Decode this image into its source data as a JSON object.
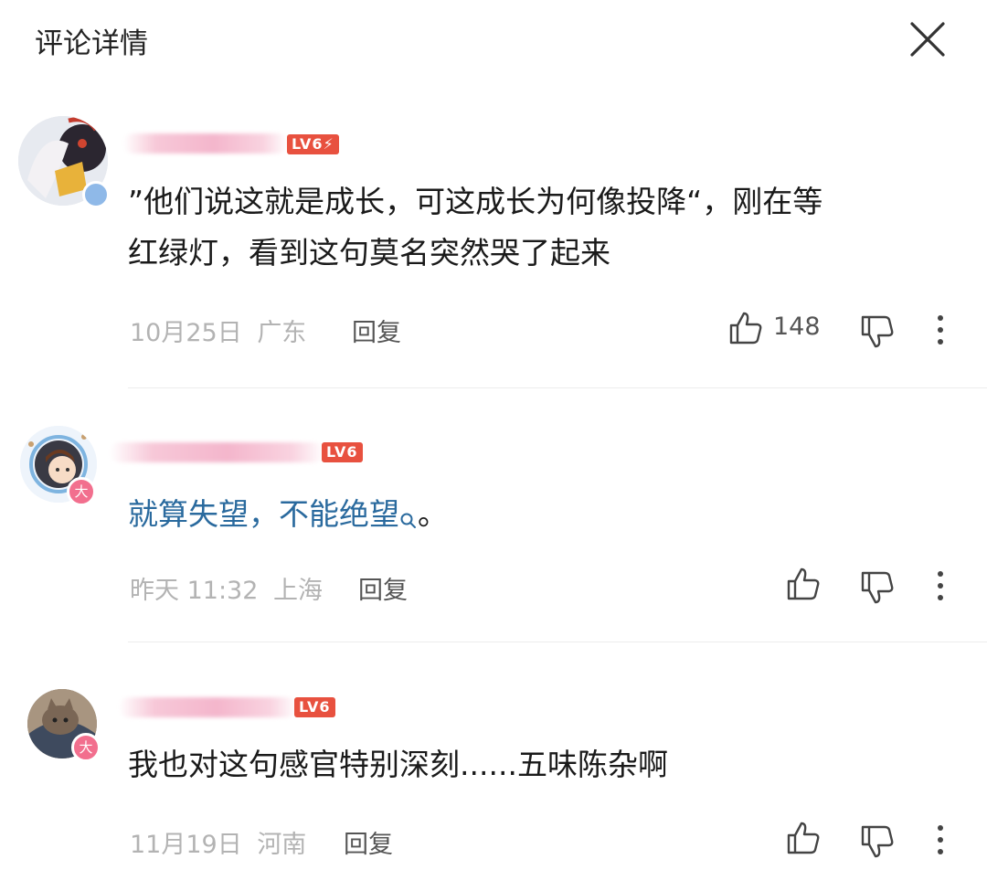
{
  "header": {
    "title": "评论详情"
  },
  "comments": [
    {
      "level": "LV6",
      "text_lines": [
        "”他们说这就是成长，可这成长为何像投降“，刚在等",
        "红绿灯，看到这句莫名突然哭了起来"
      ],
      "date": "10月25日",
      "location": "广东",
      "reply_label": "回复",
      "likes": "148"
    },
    {
      "level": "LV6",
      "text": "就算失望，不能绝望",
      "text_tail": "。",
      "badge": "大",
      "date": "昨天 11:32",
      "location": "上海",
      "reply_label": "回复"
    },
    {
      "level": "LV6",
      "text": "我也对这句感官特别深刻......五味陈杂啊",
      "badge": "大",
      "date": "11月19日",
      "location": "河南",
      "reply_label": "回复"
    }
  ]
}
